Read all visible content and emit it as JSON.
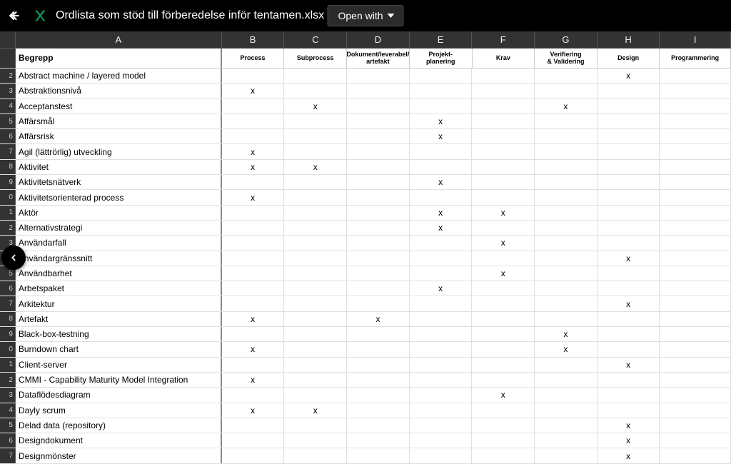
{
  "header": {
    "filename": "Ordlista som stöd till förberedelse inför tentamen.xlsx",
    "open_with": "Open with"
  },
  "columns": {
    "letters": [
      "A",
      "B",
      "C",
      "D",
      "E",
      "F",
      "G",
      "H",
      "I"
    ],
    "labels": [
      "Begrepp",
      "Process",
      "Subprocess",
      "Dokument/leverabel/\nartefakt",
      "Projekt-\nplanering",
      "Krav",
      "Verifiering\n& Validering",
      "Design",
      "Programmering"
    ]
  },
  "rows": [
    {
      "n": "2",
      "a": "Abstract machine / layered model",
      "b": "",
      "c": "",
      "d": "",
      "e": "",
      "f": "",
      "g": "",
      "h": "x",
      "i": ""
    },
    {
      "n": "3",
      "a": "Abstraktionsnivå",
      "b": "x",
      "c": "",
      "d": "",
      "e": "",
      "f": "",
      "g": "",
      "h": "",
      "i": ""
    },
    {
      "n": "4",
      "a": "Acceptanstest",
      "b": "",
      "c": "x",
      "d": "",
      "e": "",
      "f": "",
      "g": "x",
      "h": "",
      "i": ""
    },
    {
      "n": "5",
      "a": "Affärsmål",
      "b": "",
      "c": "",
      "d": "",
      "e": "x",
      "f": "",
      "g": "",
      "h": "",
      "i": ""
    },
    {
      "n": "6",
      "a": "Affärsrisk",
      "b": "",
      "c": "",
      "d": "",
      "e": "x",
      "f": "",
      "g": "",
      "h": "",
      "i": ""
    },
    {
      "n": "7",
      "a": "Agil (lättrörlig) utveckling",
      "b": "x",
      "c": "",
      "d": "",
      "e": "",
      "f": "",
      "g": "",
      "h": "",
      "i": ""
    },
    {
      "n": "8",
      "a": "Aktivitet",
      "b": "x",
      "c": "x",
      "d": "",
      "e": "",
      "f": "",
      "g": "",
      "h": "",
      "i": ""
    },
    {
      "n": "9",
      "a": "Aktivitetsnätverk",
      "b": "",
      "c": "",
      "d": "",
      "e": "x",
      "f": "",
      "g": "",
      "h": "",
      "i": ""
    },
    {
      "n": "0",
      "a": "Aktivitetsorienterad process",
      "b": "x",
      "c": "",
      "d": "",
      "e": "",
      "f": "",
      "g": "",
      "h": "",
      "i": ""
    },
    {
      "n": "1",
      "a": "Aktör",
      "b": "",
      "c": "",
      "d": "",
      "e": "x",
      "f": "x",
      "g": "",
      "h": "",
      "i": ""
    },
    {
      "n": "2",
      "a": "Alternativstrategi",
      "b": "",
      "c": "",
      "d": "",
      "e": "x",
      "f": "",
      "g": "",
      "h": "",
      "i": ""
    },
    {
      "n": "3",
      "a": "Användarfall",
      "b": "",
      "c": "",
      "d": "",
      "e": "",
      "f": "x",
      "g": "",
      "h": "",
      "i": ""
    },
    {
      "n": "4",
      "a": "Användargränssnitt",
      "b": "",
      "c": "",
      "d": "",
      "e": "",
      "f": "",
      "g": "",
      "h": "x",
      "i": ""
    },
    {
      "n": "5",
      "a": "Användbarhet",
      "b": "",
      "c": "",
      "d": "",
      "e": "",
      "f": "x",
      "g": "",
      "h": "",
      "i": ""
    },
    {
      "n": "6",
      "a": "Arbetspaket",
      "b": "",
      "c": "",
      "d": "",
      "e": "x",
      "f": "",
      "g": "",
      "h": "",
      "i": ""
    },
    {
      "n": "7",
      "a": "Arkitektur",
      "b": "",
      "c": "",
      "d": "",
      "e": "",
      "f": "",
      "g": "",
      "h": "x",
      "i": ""
    },
    {
      "n": "8",
      "a": "Artefakt",
      "b": "x",
      "c": "",
      "d": "x",
      "e": "",
      "f": "",
      "g": "",
      "h": "",
      "i": ""
    },
    {
      "n": "9",
      "a": "Black-box-testning",
      "b": "",
      "c": "",
      "d": "",
      "e": "",
      "f": "",
      "g": "x",
      "h": "",
      "i": ""
    },
    {
      "n": "0",
      "a": "Burndown chart",
      "b": "x",
      "c": "",
      "d": "",
      "e": "",
      "f": "",
      "g": "x",
      "h": "",
      "i": ""
    },
    {
      "n": "1",
      "a": "Client-server",
      "b": "",
      "c": "",
      "d": "",
      "e": "",
      "f": "",
      "g": "",
      "h": "x",
      "i": ""
    },
    {
      "n": "2",
      "a": "CMMI - Capability Maturity Model Integration",
      "b": "x",
      "c": "",
      "d": "",
      "e": "",
      "f": "",
      "g": "",
      "h": "",
      "i": ""
    },
    {
      "n": "3",
      "a": "Dataflödesdiagram",
      "b": "",
      "c": "",
      "d": "",
      "e": "",
      "f": "x",
      "g": "",
      "h": "",
      "i": ""
    },
    {
      "n": "4",
      "a": "Dayly scrum",
      "b": "x",
      "c": "x",
      "d": "",
      "e": "",
      "f": "",
      "g": "",
      "h": "",
      "i": ""
    },
    {
      "n": "5",
      "a": "Delad data (repository)",
      "b": "",
      "c": "",
      "d": "",
      "e": "",
      "f": "",
      "g": "",
      "h": "x",
      "i": ""
    },
    {
      "n": "6",
      "a": "Designdokument",
      "b": "",
      "c": "",
      "d": "",
      "e": "",
      "f": "",
      "g": "",
      "h": "x",
      "i": ""
    },
    {
      "n": "7",
      "a": "Designmönster",
      "b": "",
      "c": "",
      "d": "",
      "e": "",
      "f": "",
      "g": "",
      "h": "x",
      "i": ""
    }
  ]
}
